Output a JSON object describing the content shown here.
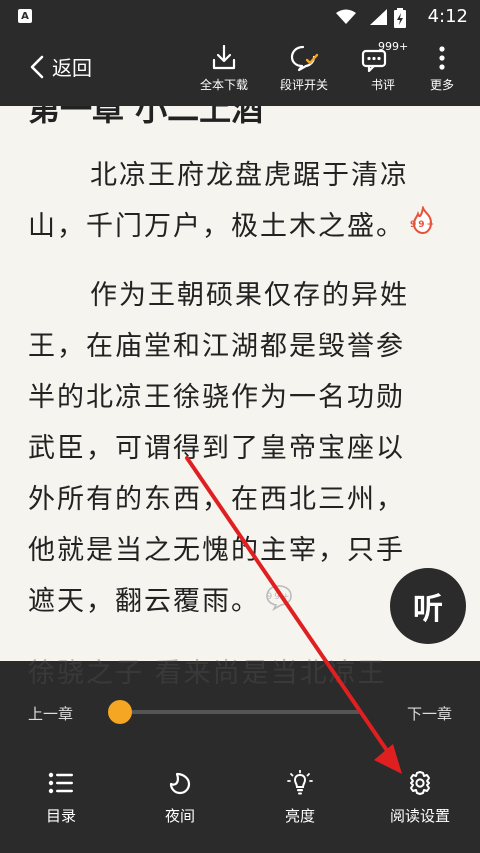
{
  "status_bar": {
    "app_badge": "A",
    "time": "4:12"
  },
  "toolbar": {
    "back_label": "返回",
    "download_label": "全本下载",
    "comment_toggle_label": "段评开关",
    "book_review_label": "书评",
    "book_review_count": "999+",
    "more_label": "更多"
  },
  "content": {
    "chapter_title": "第一章 小二上酒",
    "paragraphs": [
      {
        "lines": [
          "北凉王府龙盘虎踞于清凉",
          "山，千门万户，极土木之盛。"
        ],
        "comment_badge": "99+"
      },
      {
        "lines": [
          "作为王朝硕果仅存的异姓",
          "王，在庙堂和江湖都是毁誉参",
          "半的北凉王徐骁作为一名功勋",
          "武臣，可谓得到了皇帝宝座以",
          "外所有的东西，在西北三州，",
          "他就是当之无愧的主宰，只手",
          "遮天，翻云覆雨。"
        ],
        "comment_badge": "99+"
      }
    ],
    "peek_text": "徐骁之子 看来尚是当北凉王"
  },
  "listen_button": {
    "label": "听"
  },
  "chapter_nav": {
    "prev_label": "上一章",
    "next_label": "下一章",
    "progress": 0
  },
  "bottom_nav": {
    "catalog_label": "目录",
    "night_label": "夜间",
    "brightness_label": "亮度",
    "settings_label": "阅读设置"
  },
  "colors": {
    "toolbar_bg": "#2b2b2b",
    "page_bg": "#f6f4ef",
    "accent": "#f5a623",
    "comment_badge": "#e8523a",
    "arrow": "#e02020"
  }
}
